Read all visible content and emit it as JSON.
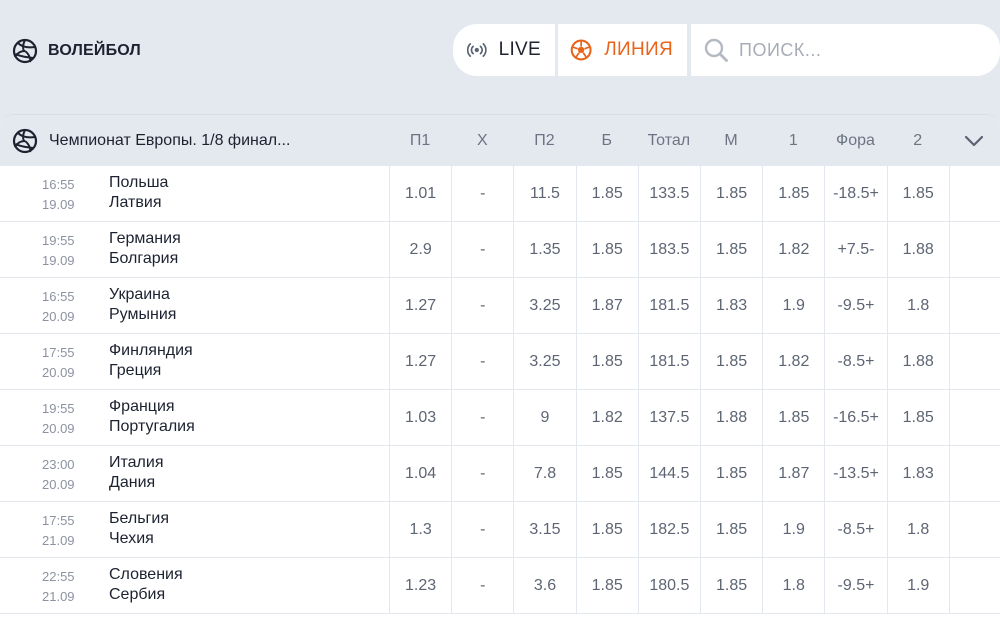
{
  "sport": {
    "title": "ВОЛЕЙБОЛ",
    "icon": "volleyball-icon"
  },
  "modes": {
    "live_label": "LIVE",
    "line_label": "ЛИНИЯ",
    "active": "line",
    "accent_color": "#e8641b"
  },
  "search": {
    "placeholder": "ПОИСК..."
  },
  "league": {
    "name": "Чемпионат Европы. 1/8 финал...",
    "columns": [
      "П1",
      "Х",
      "П2",
      "Б",
      "Тотал",
      "М",
      "1",
      "Фора",
      "2"
    ]
  },
  "matches": [
    {
      "time": "16:55",
      "date": "19.09",
      "team1": "Польша",
      "team2": "Латвия",
      "odds": [
        "1.01",
        "-",
        "11.5",
        "1.85",
        "133.5",
        "1.85",
        "1.85",
        "-18.5+",
        "1.85"
      ]
    },
    {
      "time": "19:55",
      "date": "19.09",
      "team1": "Германия",
      "team2": "Болгария",
      "odds": [
        "2.9",
        "-",
        "1.35",
        "1.85",
        "183.5",
        "1.85",
        "1.82",
        "+7.5-",
        "1.88"
      ]
    },
    {
      "time": "16:55",
      "date": "20.09",
      "team1": "Украина",
      "team2": "Румыния",
      "odds": [
        "1.27",
        "-",
        "3.25",
        "1.87",
        "181.5",
        "1.83",
        "1.9",
        "-9.5+",
        "1.8"
      ]
    },
    {
      "time": "17:55",
      "date": "20.09",
      "team1": "Финляндия",
      "team2": "Греция",
      "odds": [
        "1.27",
        "-",
        "3.25",
        "1.85",
        "181.5",
        "1.85",
        "1.82",
        "-8.5+",
        "1.88"
      ]
    },
    {
      "time": "19:55",
      "date": "20.09",
      "team1": "Франция",
      "team2": "Португалия",
      "odds": [
        "1.03",
        "-",
        "9",
        "1.82",
        "137.5",
        "1.88",
        "1.85",
        "-16.5+",
        "1.85"
      ]
    },
    {
      "time": "23:00",
      "date": "20.09",
      "team1": "Италия",
      "team2": "Дания",
      "odds": [
        "1.04",
        "-",
        "7.8",
        "1.85",
        "144.5",
        "1.85",
        "1.87",
        "-13.5+",
        "1.83"
      ]
    },
    {
      "time": "17:55",
      "date": "21.09",
      "team1": "Бельгия",
      "team2": "Чехия",
      "odds": [
        "1.3",
        "-",
        "3.15",
        "1.85",
        "182.5",
        "1.85",
        "1.9",
        "-8.5+",
        "1.8"
      ]
    },
    {
      "time": "22:55",
      "date": "21.09",
      "team1": "Словения",
      "team2": "Сербия",
      "odds": [
        "1.23",
        "-",
        "3.6",
        "1.85",
        "180.5",
        "1.85",
        "1.8",
        "-9.5+",
        "1.9"
      ]
    }
  ]
}
